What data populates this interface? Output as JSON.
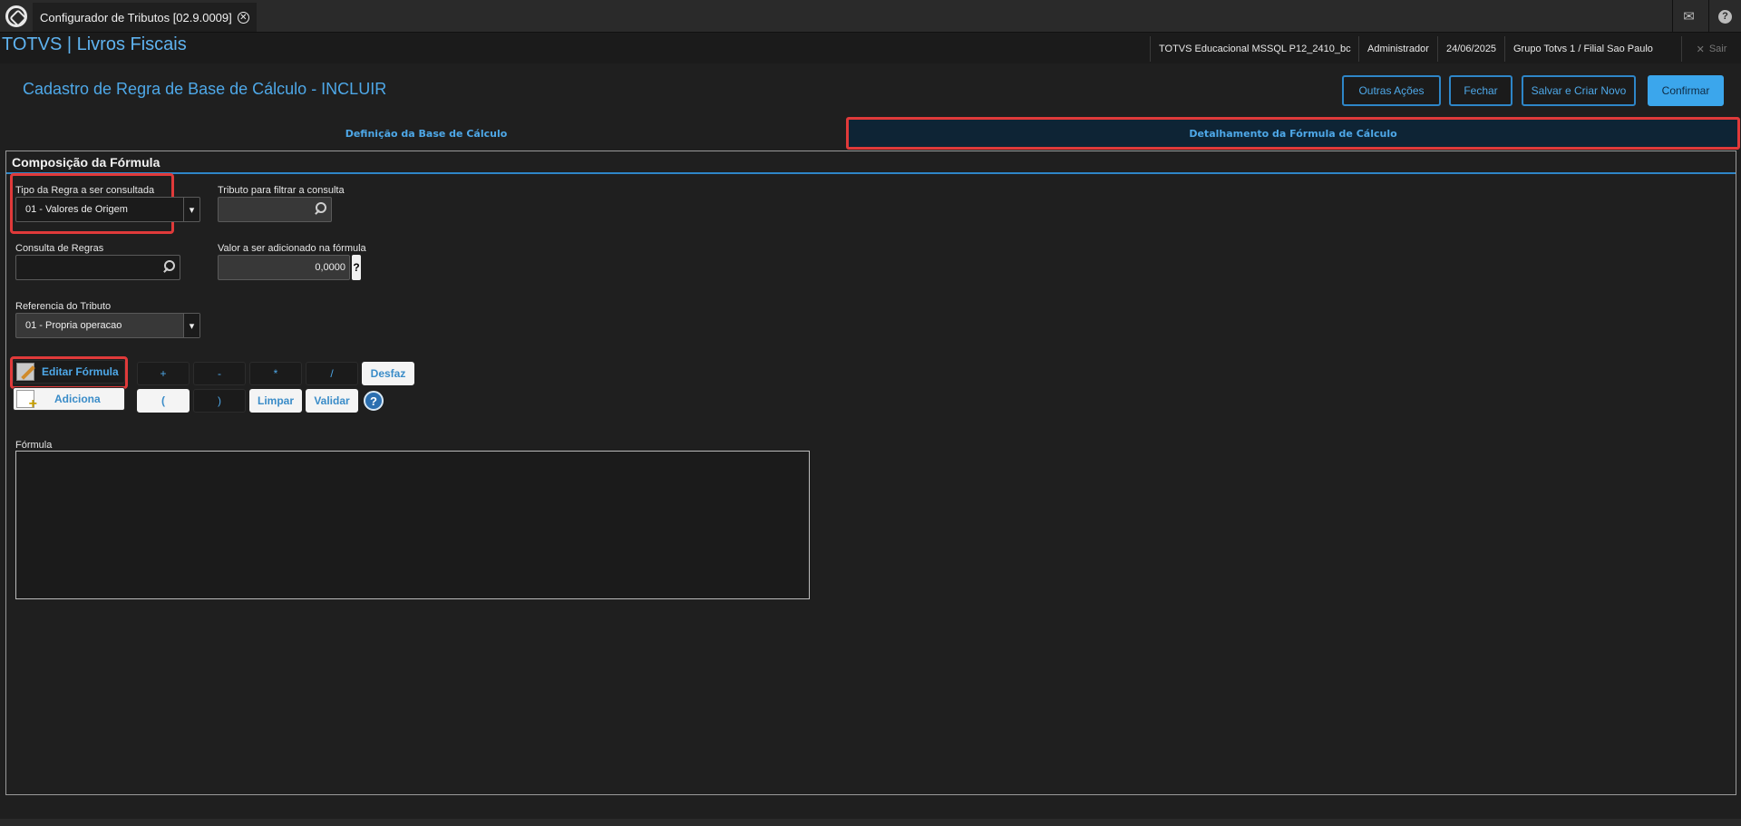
{
  "window": {
    "tab_title": "Configurador de Tributos [02.9.0009]",
    "close_glyph": "✕"
  },
  "header": {
    "brand": "TOTVS | Livros Fiscais",
    "environment": "TOTVS Educacional MSSQL P12_2410_bc",
    "user": "Administrador",
    "date": "24/06/2025",
    "branch": "Grupo Totvs 1 / Filial Sao Paulo",
    "exit_label": "Sair",
    "icons": [
      "mail-icon",
      "help-icon",
      "close-icon"
    ]
  },
  "form": {
    "title": "Cadastro de Regra de Base de Cálculo - INCLUIR",
    "actions": {
      "other": "Outras Ações",
      "close": "Fechar",
      "save_new": "Salvar e Criar Novo",
      "confirm": "Confirmar"
    }
  },
  "folders": [
    {
      "label": "Definição da Base de Cálculo",
      "active": false
    },
    {
      "label": "Detalhamento da Fórmula de Cálculo",
      "active": true
    }
  ],
  "panel": {
    "title": "Composição da Fórmula",
    "rule_type": {
      "label": "Tipo da Regra a ser consultada",
      "value": "01 - Valores de Origem"
    },
    "tribute_filter": {
      "label": "Tributo para filtrar a consulta",
      "value": ""
    },
    "rules_query": {
      "label": "Consulta de Regras",
      "value": ""
    },
    "value_to_add": {
      "label": "Valor a ser adicionado na fórmula",
      "value": "0,0000",
      "help": "?"
    },
    "tribute_reference": {
      "label": "Referencia do Tributo",
      "value": "01 - Propria operacao"
    },
    "edit_formula": "Editar Fórmula",
    "add": "Adiciona",
    "operators": {
      "plus": "+",
      "minus": "-",
      "times": "*",
      "divide": "/",
      "undo": "Desfaz",
      "open_paren": "(",
      "close_paren": ")",
      "clear": "Limpar",
      "validate": "Validar",
      "help": "?"
    },
    "formula": {
      "label": "Fórmula",
      "value": ""
    }
  },
  "colors": {
    "accent": "#4ea8e8",
    "highlight": "#e03a3a",
    "background": "#1f1f1f"
  }
}
